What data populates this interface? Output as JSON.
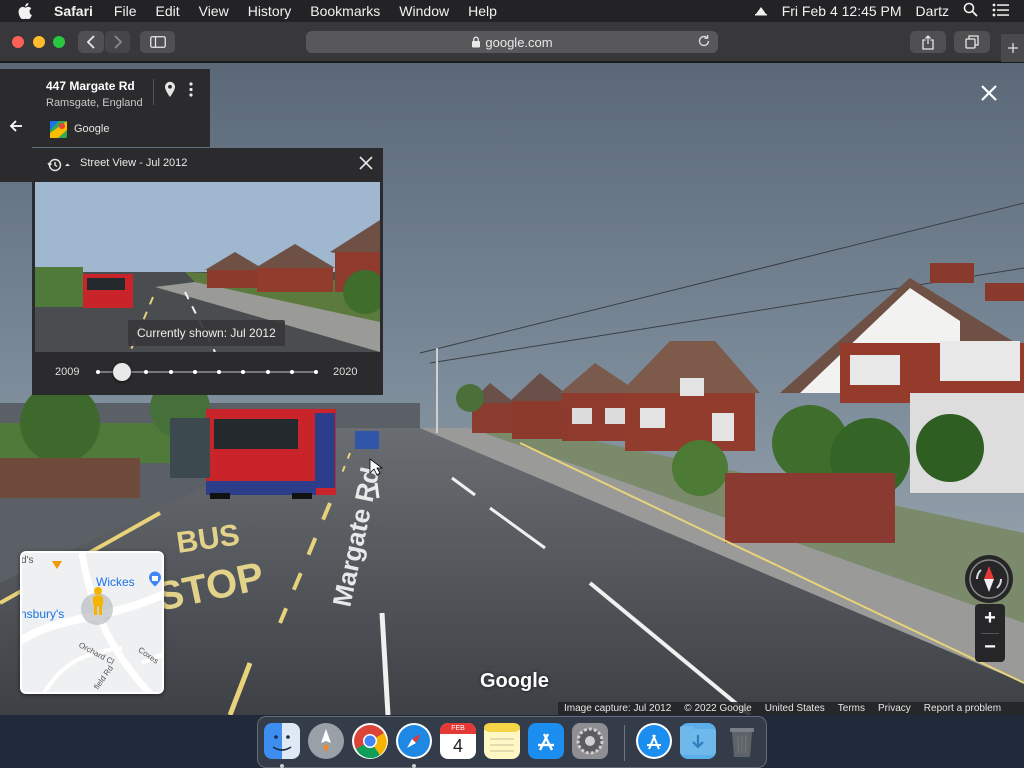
{
  "menubar": {
    "app_name": "Safari",
    "menus": [
      "File",
      "Edit",
      "View",
      "History",
      "Bookmarks",
      "Window",
      "Help"
    ],
    "clock": "Fri Feb 4  12:45 PM",
    "user": "Dartz"
  },
  "browser": {
    "url": "google.com"
  },
  "place": {
    "title": "447 Margate Rd",
    "subtitle": "Ramsgate, England",
    "provider": "Google"
  },
  "time_panel": {
    "title": "Street View - Jul 2012",
    "tooltip": "Currently shown: Jul 2012",
    "year_start": "2009",
    "year_end": "2020",
    "snapshot_count": 10,
    "selected_snapshot": 2
  },
  "scene_text": {
    "road_marking_1": "BUS",
    "road_marking_2": "STOP",
    "road_name": "Margate Rd",
    "watermark": "Google"
  },
  "minimap": {
    "label_1": "Wickes",
    "label_2": "nsbury's",
    "label_3": "Orchard Cl",
    "label_4": "Coxes",
    "label_5": "field Rd",
    "label_6": "d's"
  },
  "footer": {
    "items": [
      "Image capture: Jul 2012",
      "© 2022 Google",
      "United States",
      "Terms",
      "Privacy",
      "Report a problem"
    ]
  },
  "dock": {
    "calendar_month": "FEB",
    "calendar_day": "4"
  },
  "colors": {
    "menubar": "#232325",
    "toolbar": "#38383a",
    "panel": "#2b2b2d",
    "accent_blue": "#1a73e8",
    "bus_red": "#c8242a"
  },
  "icons": [
    "apple-icon",
    "airplay-icon",
    "search-icon",
    "control-center-icon",
    "back-icon",
    "forward-icon",
    "sidebar-icon",
    "lock-icon",
    "reload-icon",
    "share-icon",
    "tabs-icon",
    "new-tab-icon",
    "pin-icon",
    "more-icon",
    "history-icon",
    "close-icon",
    "pegman-icon",
    "compass-icon"
  ]
}
